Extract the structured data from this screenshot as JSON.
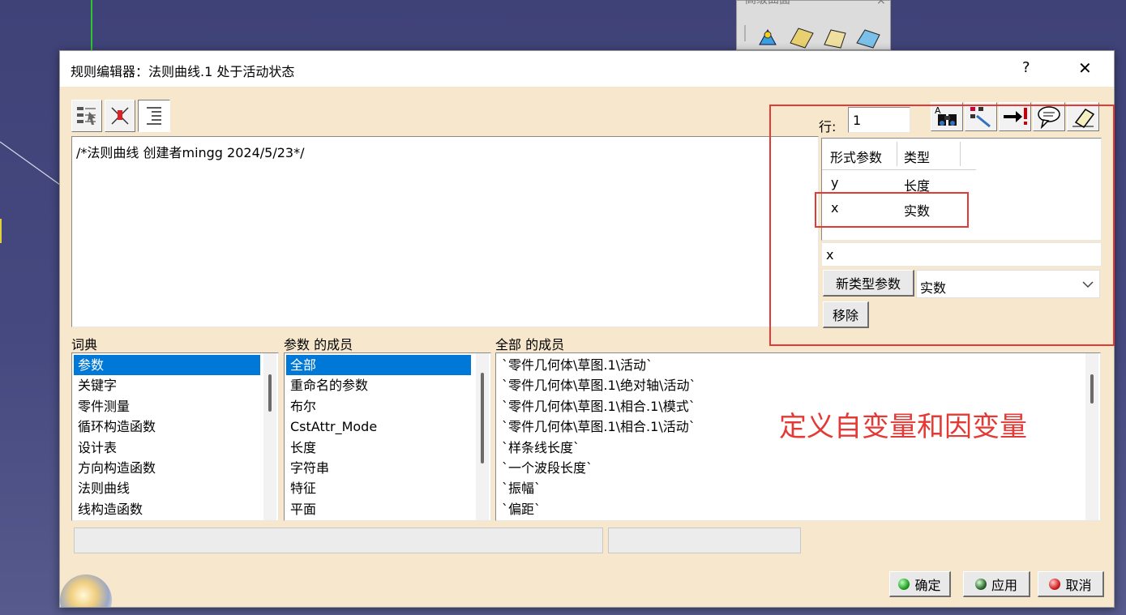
{
  "background_toolbar": {
    "title": "高级曲面",
    "close": "×"
  },
  "window": {
    "title": "规则编辑器：法则曲线.1 处于活动状态",
    "help": "?",
    "close": "✕"
  },
  "editor": {
    "content": "/*法则曲线 创建者mingg 2024/5/23*/"
  },
  "row": {
    "label": "行:",
    "value": "1"
  },
  "params_table": {
    "headers": [
      "形式参数",
      "类型"
    ],
    "rows": [
      {
        "name": "y",
        "type": "长度"
      },
      {
        "name": "x",
        "type": "实数"
      }
    ]
  },
  "param_name_input": "x",
  "new_type_button": "新类型参数",
  "type_select": "实数",
  "remove_button": "移除",
  "dictionary": {
    "label": "词典",
    "items": [
      "参数",
      "关键字",
      "零件测量",
      "循环构造函数",
      "设计表",
      "方向构造函数",
      "法则曲线",
      "线构造函数"
    ],
    "selected": 0
  },
  "members": {
    "label": "参数 的成员",
    "items": [
      "全部",
      "重命名的参数",
      "布尔",
      "CstAttr_Mode",
      "长度",
      "字符串",
      "特征",
      "平面"
    ],
    "selected": 0
  },
  "all_members": {
    "label": "全部 的成员",
    "items": [
      "`零件几何体\\草图.1\\活动`",
      "`零件几何体\\草图.1\\绝对轴\\活动`",
      "`零件几何体\\草图.1\\相合.1\\模式`",
      "`零件几何体\\草图.1\\相合.1\\活动`",
      "`样条线长度`",
      "`一个波段长度`",
      "`振幅`",
      "`偏距`"
    ]
  },
  "annotation": {
    "text": "定义自变量和因变量",
    "color": "#e53935"
  },
  "footer": {
    "ok": "确定",
    "apply": "应用",
    "cancel": "取消"
  }
}
